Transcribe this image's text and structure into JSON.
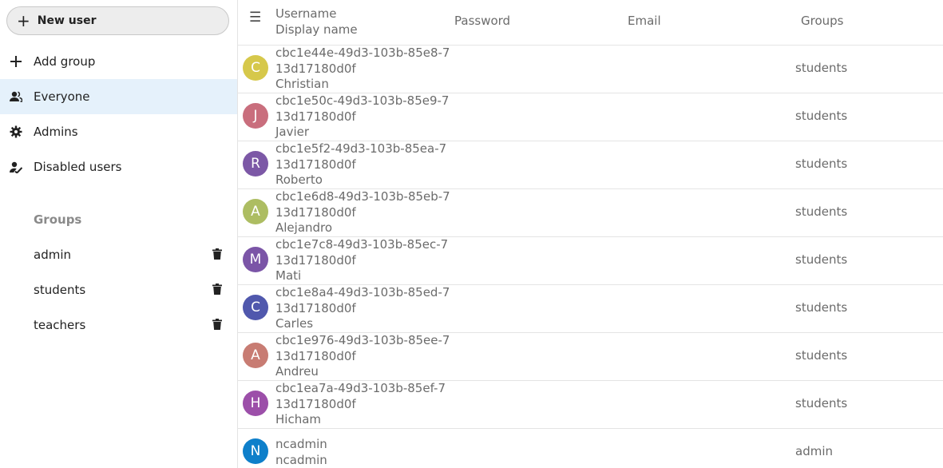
{
  "sidebar": {
    "new_user_label": "New user",
    "nav": [
      {
        "label": "Add group",
        "icon": "plus-icon"
      },
      {
        "label": "Everyone",
        "icon": "contacts-icon",
        "active": true
      },
      {
        "label": "Admins",
        "icon": "shield-cog-icon"
      },
      {
        "label": "Disabled users",
        "icon": "account-off-icon"
      }
    ],
    "groups_caption": "Groups",
    "groups": [
      {
        "label": "admin"
      },
      {
        "label": "students"
      },
      {
        "label": "teachers"
      }
    ]
  },
  "table": {
    "header": {
      "username": "Username",
      "display_name": "Display name",
      "password": "Password",
      "email": "Email",
      "groups": "Groups"
    },
    "rows": [
      {
        "initial": "C",
        "color": "#d6c84b",
        "username": "cbc1e44e-49d3-103b-85e8-713d17180d0f",
        "display": "Christian",
        "groups": "students"
      },
      {
        "initial": "J",
        "color": "#c96e7d",
        "username": "cbc1e50c-49d3-103b-85e9-713d17180d0f",
        "display": "Javier",
        "groups": "students"
      },
      {
        "initial": "R",
        "color": "#7c58a6",
        "username": "cbc1e5f2-49d3-103b-85ea-713d17180d0f",
        "display": "Roberto",
        "groups": "students"
      },
      {
        "initial": "A",
        "color": "#adbd62",
        "username": "cbc1e6d8-49d3-103b-85eb-713d17180d0f",
        "display": "Alejandro",
        "groups": "students"
      },
      {
        "initial": "M",
        "color": "#7b55a7",
        "username": "cbc1e7c8-49d3-103b-85ec-713d17180d0f",
        "display": "Mati",
        "groups": "students"
      },
      {
        "initial": "C",
        "color": "#5058ad",
        "username": "cbc1e8a4-49d3-103b-85ed-713d17180d0f",
        "display": "Carles",
        "groups": "students"
      },
      {
        "initial": "A",
        "color": "#c87c73",
        "username": "cbc1e976-49d3-103b-85ee-713d17180d0f",
        "display": "Andreu",
        "groups": "students"
      },
      {
        "initial": "H",
        "color": "#9c4fa9",
        "username": "cbc1ea7a-49d3-103b-85ef-713d17180d0f",
        "display": "Hicham",
        "groups": "students"
      },
      {
        "initial": "N",
        "color": "#0e7fca",
        "username": "ncadmin",
        "display": "ncadmin",
        "groups": "admin"
      }
    ]
  }
}
